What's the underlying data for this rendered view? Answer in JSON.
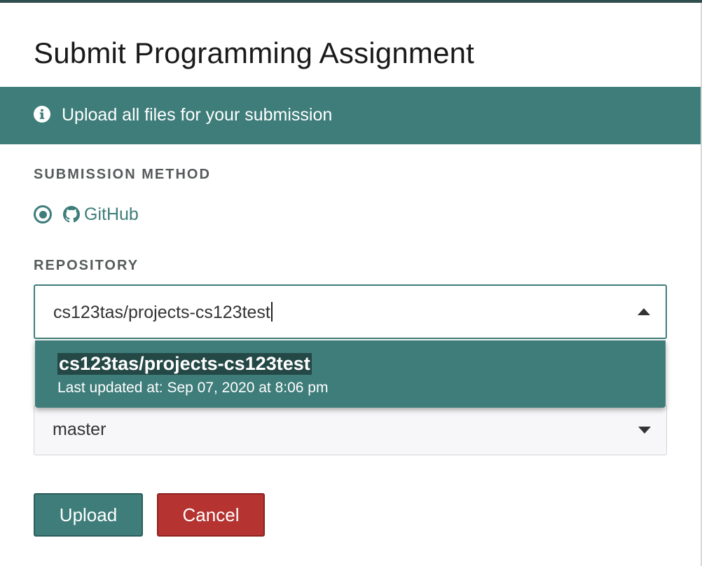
{
  "dialog": {
    "title": "Submit Programming Assignment"
  },
  "banner": {
    "icon": "info-icon",
    "message": "Upload all files for your submission"
  },
  "submission_method": {
    "label": "SUBMISSION METHOD",
    "options": [
      {
        "label": "GitHub",
        "icon": "github-icon",
        "selected": true
      }
    ]
  },
  "repository": {
    "label": "REPOSITORY",
    "input_value": "cs123tas/projects-cs123test",
    "dropdown_open": true,
    "options": [
      {
        "name": "cs123tas/projects-cs123test",
        "updated": "Last updated at: Sep 07, 2020 at 8:06 pm"
      }
    ]
  },
  "branch": {
    "value": "master"
  },
  "buttons": {
    "upload": "Upload",
    "cancel": "Cancel"
  },
  "colors": {
    "accent": "#3e7d7a",
    "danger": "#b53330",
    "highlight": "#244846"
  }
}
